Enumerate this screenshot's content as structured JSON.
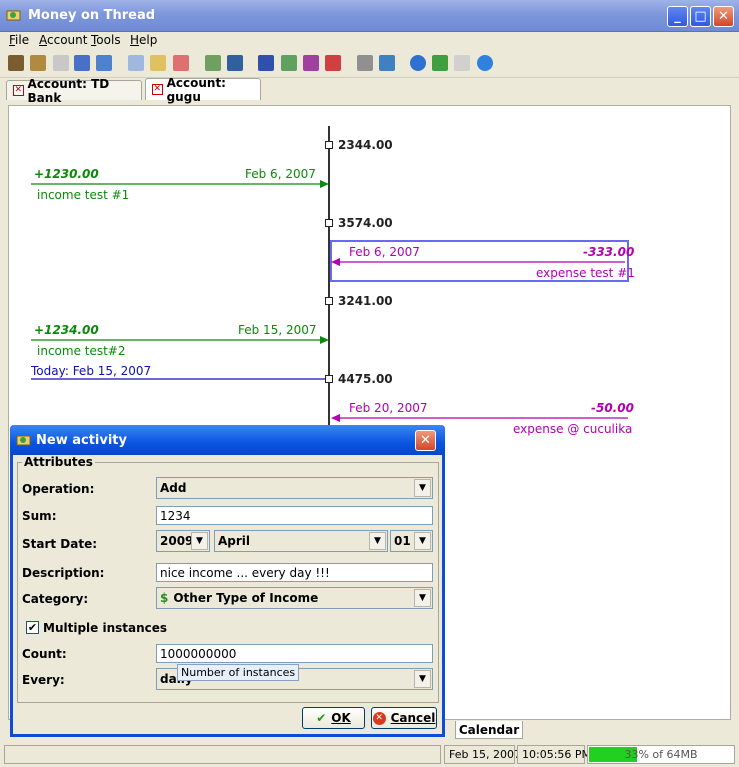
{
  "window": {
    "title": "Money on Thread"
  },
  "menu": {
    "items": [
      "File",
      "Account",
      "Tools",
      "Help"
    ]
  },
  "tabs": [
    {
      "label": "Account: TD Bank"
    },
    {
      "label": "Account: gugu"
    }
  ],
  "timeline": {
    "balances": [
      "2344.00",
      "3574.00",
      "3241.00",
      "4475.00"
    ],
    "entries": [
      {
        "amount": "+1230.00",
        "date": "Feb 6, 2007",
        "desc": "income test #1"
      },
      {
        "amount": "-333.00",
        "date": "Feb 6, 2007",
        "desc": "expense test #1"
      },
      {
        "amount": "+1234.00",
        "date": "Feb 15, 2007",
        "desc": "income test#2"
      },
      {
        "amount": "-50.00",
        "date": "Feb 20, 2007",
        "desc": "expense @ cuculika"
      }
    ],
    "today": "Today: Feb 15, 2007"
  },
  "bottom_tab": {
    "label": "Calendar"
  },
  "status": {
    "date": "Feb 15, 2007",
    "time": "10:05:56 PM",
    "memory": "33% of 64MB",
    "memory_fraction": 0.33
  },
  "dialog": {
    "title": "New  activity",
    "group": "Attributes",
    "operation": {
      "label": "Operation:",
      "value": "Add"
    },
    "sum": {
      "label": "Sum:",
      "value": "1234"
    },
    "start_date": {
      "label": "Start Date:",
      "year": "2009",
      "month": "April",
      "day": "01"
    },
    "description": {
      "label": "Description:",
      "value": "nice income ... every day !!!"
    },
    "category": {
      "label": "Category:",
      "value": "Other Type of Income"
    },
    "multiple": {
      "label": "Multiple instances",
      "checked": true
    },
    "count": {
      "label": "Count:",
      "value": "1000000000"
    },
    "every": {
      "label": "Every:",
      "value": "daily"
    },
    "tooltip": "Number of instances",
    "ok_label": "OK",
    "cancel_label": "Cancel"
  },
  "colors": {
    "income": "#0a8a0a",
    "expense": "#b300b3",
    "today": "#1010b0",
    "selection": "#6a6af0"
  }
}
